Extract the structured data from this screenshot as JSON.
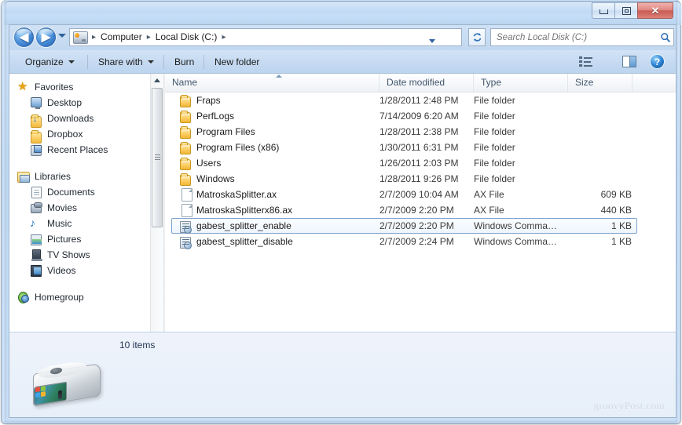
{
  "window": {
    "minimize_label": "Minimize",
    "maximize_label": "Maximize",
    "close_label": "✕"
  },
  "address_bar": {
    "back_label": "◀",
    "forward_label": "▶",
    "crumbs": [
      "Computer",
      "Local Disk (C:)"
    ],
    "separator": "▸",
    "refresh_label": "↻"
  },
  "search": {
    "placeholder": "Search Local Disk (C:)",
    "value": ""
  },
  "command_bar": {
    "organize": "Organize",
    "share_with": "Share with",
    "burn": "Burn",
    "new_folder": "New folder",
    "help_label": "?"
  },
  "nav_pane": {
    "groups": [
      {
        "header": "Favorites",
        "icon": "star-icon",
        "items": [
          {
            "label": "Desktop",
            "icon": "desktop-icon"
          },
          {
            "label": "Downloads",
            "icon": "downloads-folder-icon"
          },
          {
            "label": "Dropbox",
            "icon": "folder-icon"
          },
          {
            "label": "Recent Places",
            "icon": "recent-places-icon"
          }
        ]
      },
      {
        "header": "Libraries",
        "icon": "libraries-icon",
        "items": [
          {
            "label": "Documents",
            "icon": "document-icon"
          },
          {
            "label": "Movies",
            "icon": "movies-icon"
          },
          {
            "label": "Music",
            "icon": "music-note-icon"
          },
          {
            "label": "Pictures",
            "icon": "picture-icon"
          },
          {
            "label": "TV Shows",
            "icon": "tv-icon"
          },
          {
            "label": "Videos",
            "icon": "video-icon"
          }
        ]
      },
      {
        "header": "Homegroup",
        "icon": "homegroup-icon",
        "items": []
      }
    ]
  },
  "file_list": {
    "columns": [
      {
        "key": "name",
        "label": "Name",
        "sorted": "asc"
      },
      {
        "key": "date",
        "label": "Date modified"
      },
      {
        "key": "type",
        "label": "Type"
      },
      {
        "key": "size",
        "label": "Size"
      }
    ],
    "rows": [
      {
        "name": "Fraps",
        "date": "1/28/2011 2:48 PM",
        "type": "File folder",
        "size": "",
        "icon": "folder-icon",
        "selected": false
      },
      {
        "name": "PerfLogs",
        "date": "7/14/2009 6:20 AM",
        "type": "File folder",
        "size": "",
        "icon": "folder-icon",
        "selected": false
      },
      {
        "name": "Program Files",
        "date": "1/28/2011 2:38 PM",
        "type": "File folder",
        "size": "",
        "icon": "folder-icon",
        "selected": false
      },
      {
        "name": "Program Files (x86)",
        "date": "1/30/2011 6:31 PM",
        "type": "File folder",
        "size": "",
        "icon": "folder-icon",
        "selected": false
      },
      {
        "name": "Users",
        "date": "1/26/2011 2:03 PM",
        "type": "File folder",
        "size": "",
        "icon": "folder-icon",
        "selected": false
      },
      {
        "name": "Windows",
        "date": "1/28/2011 9:26 PM",
        "type": "File folder",
        "size": "",
        "icon": "folder-icon",
        "selected": false
      },
      {
        "name": "MatroskaSplitter.ax",
        "date": "2/7/2009 10:04 AM",
        "type": "AX File",
        "size": "609 KB",
        "icon": "file-icon",
        "selected": false
      },
      {
        "name": "MatroskaSplitterx86.ax",
        "date": "2/7/2009 2:20 PM",
        "type": "AX File",
        "size": "440 KB",
        "icon": "file-icon",
        "selected": false
      },
      {
        "name": "gabest_splitter_enable",
        "date": "2/7/2009 2:20 PM",
        "type": "Windows Comma…",
        "size": "1 KB",
        "icon": "registry-icon",
        "selected": true
      },
      {
        "name": "gabest_splitter_disable",
        "date": "2/7/2009 2:24 PM",
        "type": "Windows Comma…",
        "size": "1 KB",
        "icon": "registry-icon",
        "selected": false
      }
    ]
  },
  "status_bar": {
    "item_count": "10 items",
    "drive_icon": "local-disk-icon"
  },
  "watermark": "groovyPost.com",
  "colors": {
    "accent": "#2f6fb5",
    "titlebar": "#b9d5f2",
    "close_button": "#c85a53",
    "selection_border": "#7da2ce"
  }
}
